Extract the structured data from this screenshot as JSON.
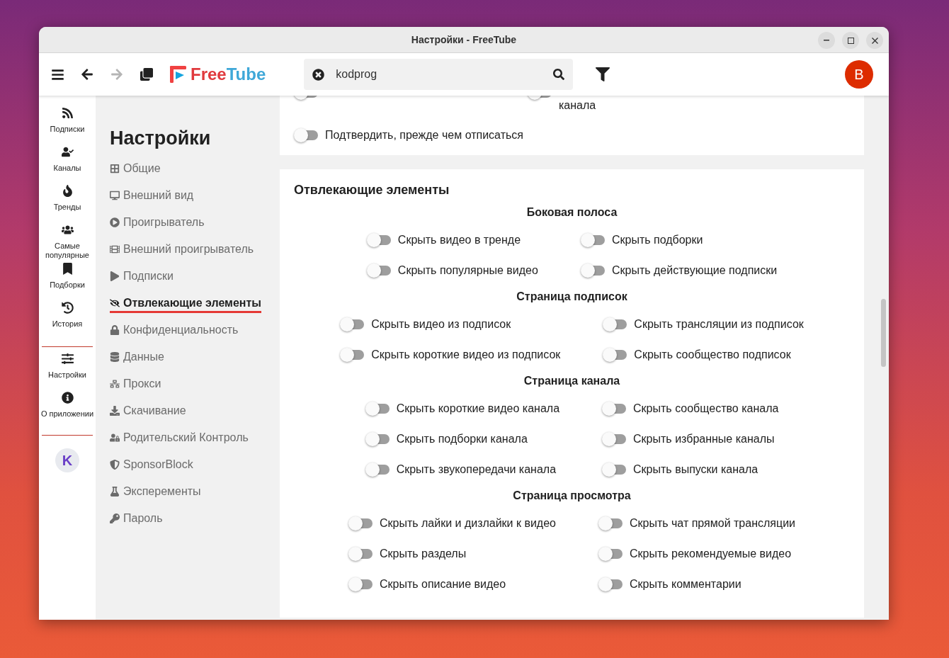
{
  "window": {
    "title": "Настройки - FreeTube"
  },
  "toolbar": {
    "nav": [
      {
        "kind": "back",
        "disabled": false
      },
      {
        "kind": "forward",
        "disabled": true
      }
    ],
    "logo": {
      "part_1": "Free",
      "part_2": "Tube"
    },
    "search": {
      "value": "kodprog"
    },
    "avatar": {
      "letter": "B"
    }
  },
  "side_nav": {
    "main": [
      {
        "kind": "rss",
        "label": "Подписки"
      },
      {
        "kind": "channels",
        "label": "Каналы"
      },
      {
        "kind": "fire",
        "label": "Тренды"
      },
      {
        "kind": "users",
        "label": "Самые популярные"
      },
      {
        "kind": "bookmark",
        "label": "Подборки"
      },
      {
        "kind": "history",
        "label": "История"
      }
    ],
    "secondary": [
      {
        "kind": "sliders",
        "label": "Настройки"
      },
      {
        "kind": "info",
        "label": "О приложении"
      }
    ],
    "profile": {
      "letter": "K"
    }
  },
  "settings_menu": {
    "title": "Настройки",
    "items": [
      {
        "kind": "grid",
        "label": "Общие",
        "selected": false
      },
      {
        "kind": "desktop",
        "label": "Внешний вид",
        "selected": false
      },
      {
        "kind": "play-circle",
        "label": "Проигрыватель",
        "selected": false
      },
      {
        "kind": "film",
        "label": "Внешний проигрыватель",
        "selected": false
      },
      {
        "kind": "play",
        "label": "Подписки",
        "selected": false
      },
      {
        "kind": "eye-slash",
        "label": "Отвлекающие элементы",
        "selected": true
      },
      {
        "kind": "lock",
        "label": "Конфиденциальность",
        "selected": false
      },
      {
        "kind": "database",
        "label": "Данные",
        "selected": false
      },
      {
        "kind": "network",
        "label": "Прокси",
        "selected": false
      },
      {
        "kind": "download",
        "label": "Скачивание",
        "selected": false
      },
      {
        "kind": "user-lock",
        "label": "Родительский Контроль",
        "selected": false
      },
      {
        "kind": "shield",
        "label": "SponsorBlock",
        "selected": false
      },
      {
        "kind": "flask",
        "label": "Эксперементы",
        "selected": false
      },
      {
        "kind": "key",
        "label": "Пароль",
        "selected": false
      }
    ]
  },
  "subscriptions_card": {
    "items": [
      {
        "on": false
      },
      {
        "label": "канала",
        "on": false
      },
      {
        "label": "Подтвердить, прежде чем отписаться",
        "on": false
      }
    ]
  },
  "distraction_card": {
    "title": "Отвлекающие элементы",
    "groups": [
      {
        "heading": "Боковая полоса",
        "items": [
          {
            "label": "Скрыть видео в тренде",
            "on": false
          },
          {
            "label": "Скрыть подборки",
            "on": false
          },
          {
            "label": "Скрыть популярные видео",
            "on": false
          },
          {
            "label": "Скрыть действующие подписки",
            "on": false
          }
        ]
      },
      {
        "heading": "Страница подписок",
        "items": [
          {
            "label": "Скрыть видео из подписок",
            "on": false
          },
          {
            "label": "Скрыть трансляции из подписок",
            "on": false
          },
          {
            "label": "Скрыть короткие видео из подписок",
            "on": false
          },
          {
            "label": "Скрыть сообщество подписок",
            "on": false
          }
        ]
      },
      {
        "heading": "Страница канала",
        "items": [
          {
            "label": "Скрыть короткие видео канала",
            "on": false
          },
          {
            "label": "Скрыть сообщество канала",
            "on": false
          },
          {
            "label": "Скрыть подборки канала",
            "on": false
          },
          {
            "label": "Скрыть избранные каналы",
            "on": false
          },
          {
            "label": "Скрыть звукопередачи канала",
            "on": false
          },
          {
            "label": "Скрыть выпуски канала",
            "on": false
          }
        ]
      },
      {
        "heading": "Страница просмотра",
        "items": [
          {
            "label": "Скрыть лайки и дизлайки к видео",
            "on": false
          },
          {
            "label": "Скрыть чат прямой трансляции",
            "on": false
          },
          {
            "label": "Скрыть разделы",
            "on": false
          },
          {
            "label": "Скрыть рекомендуемые видео",
            "on": false
          },
          {
            "label": "Скрыть описание видео",
            "on": false
          },
          {
            "label": "Скрыть комментарии",
            "on": false
          }
        ]
      }
    ]
  }
}
